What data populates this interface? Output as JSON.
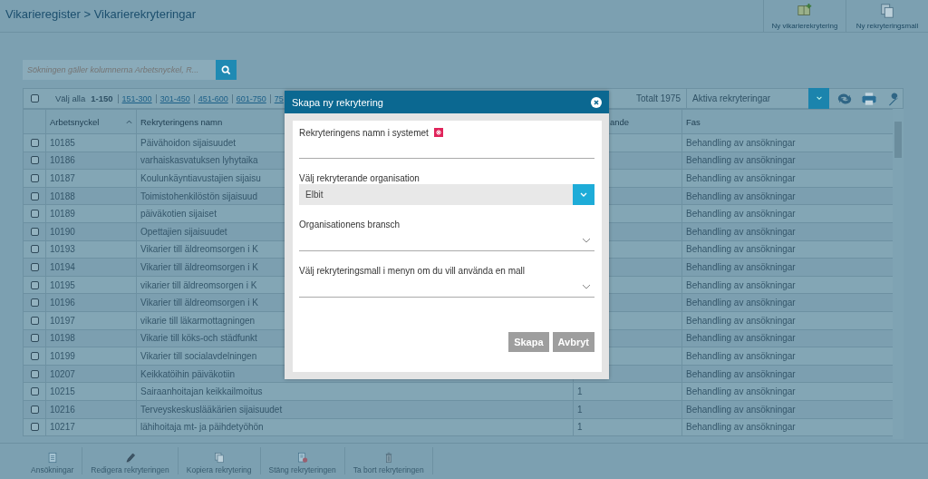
{
  "header": {
    "breadcrumb": "Vikarieregister > Vikarierekryteringar",
    "actions": [
      {
        "label": "Ny vikarierekrytering",
        "kind": "book"
      },
      {
        "label": "Ny rekryteringsmall",
        "kind": "copy"
      }
    ]
  },
  "search": {
    "placeholder": "Sökningen gäller kolumnerna Arbetsnyckel, R..."
  },
  "toolbar": {
    "select_all_checked": false,
    "select_all": "Välj alla",
    "current_range": "1-150",
    "ranges": [
      "151-300",
      "301-450",
      "451-600",
      "601-750",
      "75"
    ],
    "total": "Totalt 1975",
    "filter": "Aktiva rekryteringar"
  },
  "table": {
    "columns": [
      {
        "label": "Arbetsnyckel",
        "sorted": true
      },
      {
        "label": "Rekryteringens namn",
        "sorted": false
      },
      {
        "label": "ande",
        "sorted": false
      },
      {
        "label": "Fas",
        "sorted": false
      }
    ],
    "rows": [
      {
        "checked": false,
        "key": "10185",
        "name": "Päivähoidon sijaisuudet",
        "phase": "Behandling av ansökningar"
      },
      {
        "checked": false,
        "key": "10186",
        "name": "varhaiskasvatuksen lyhytaika",
        "phase": "Behandling av ansökningar"
      },
      {
        "checked": false,
        "key": "10187",
        "name": "Koulunkäyntiavustajien sijaisu",
        "phase": "Behandling av ansökningar"
      },
      {
        "checked": false,
        "key": "10188",
        "name": "Toimistohenkilöstön sijaisuud",
        "phase": "Behandling av ansökningar"
      },
      {
        "checked": false,
        "key": "10189",
        "name": "päiväkotien sijaiset",
        "phase": "Behandling av ansökningar"
      },
      {
        "checked": false,
        "key": "10190",
        "name": "Opettajien sijaisuudet",
        "phase": "Behandling av ansökningar"
      },
      {
        "checked": false,
        "key": "10193",
        "name": "Vikarier till äldreomsorgen i K",
        "phase": "Behandling av ansökningar"
      },
      {
        "checked": false,
        "key": "10194",
        "name": "Vikarier till äldreomsorgen i K",
        "phase": "Behandling av ansökningar"
      },
      {
        "checked": false,
        "key": "10195",
        "name": "vikarier till äldreomsorgen i K",
        "phase": "Behandling av ansökningar"
      },
      {
        "checked": false,
        "key": "10196",
        "name": "Vikarier till äldreomsorgen i K",
        "phase": "Behandling av ansökningar"
      },
      {
        "checked": false,
        "key": "10197",
        "name": "vikarie till läkarmottagningen",
        "phase": "Behandling av ansökningar"
      },
      {
        "checked": false,
        "key": "10198",
        "name": "Vikarie till köks-och städfunkt",
        "phase": "Behandling av ansökningar"
      },
      {
        "checked": false,
        "key": "10199",
        "name": "Vikarier till socialavdelningen",
        "phase": "Behandling av ansökningar"
      },
      {
        "checked": false,
        "key": "10207",
        "name": "Keikkatöihin päiväkotiin",
        "phase": "Behandling av ansökningar"
      },
      {
        "checked": false,
        "key": "10215",
        "name": "Sairaanhoitajan keikkailmoitus",
        "column_3": "1",
        "phase": "Behandling av ansökningar"
      },
      {
        "checked": false,
        "key": "10216",
        "name": "Terveyskeskuslääkärien sijaisuudet",
        "column_3": "1",
        "phase": "Behandling av ansökningar"
      },
      {
        "checked": false,
        "key": "10217",
        "name": "lähihoitaja mt- ja päihdetyöhön",
        "column_3": "1",
        "phase": "Behandling av ansökningar"
      }
    ]
  },
  "bottom_toolbar": [
    {
      "label": "Ansökningar",
      "kind": "document"
    },
    {
      "label": "Redigera rekryteringen",
      "kind": "pen"
    },
    {
      "label": "Kopiera rekrytering",
      "kind": "copy"
    },
    {
      "label": "Stäng rekryteringen",
      "kind": "close-doc"
    },
    {
      "label": "Ta bort rekryteringen",
      "kind": "trash"
    }
  ],
  "dialog": {
    "title": "Skapa ny rekrytering",
    "fields": [
      {
        "kind": "text",
        "label": "Rekryteringens namn i systemet",
        "required": true
      },
      {
        "kind": "select",
        "label": "Välj rekryterande organisation",
        "value": "Elbit",
        "required": false
      },
      {
        "kind": "dropdown",
        "label": "Organisationens bransch",
        "required": false
      },
      {
        "kind": "dropdown",
        "label": "Välj rekryteringsmall i menyn om du vill använda en mall",
        "required": false
      }
    ],
    "buttons": [
      "Skapa",
      "Avbryt"
    ]
  }
}
